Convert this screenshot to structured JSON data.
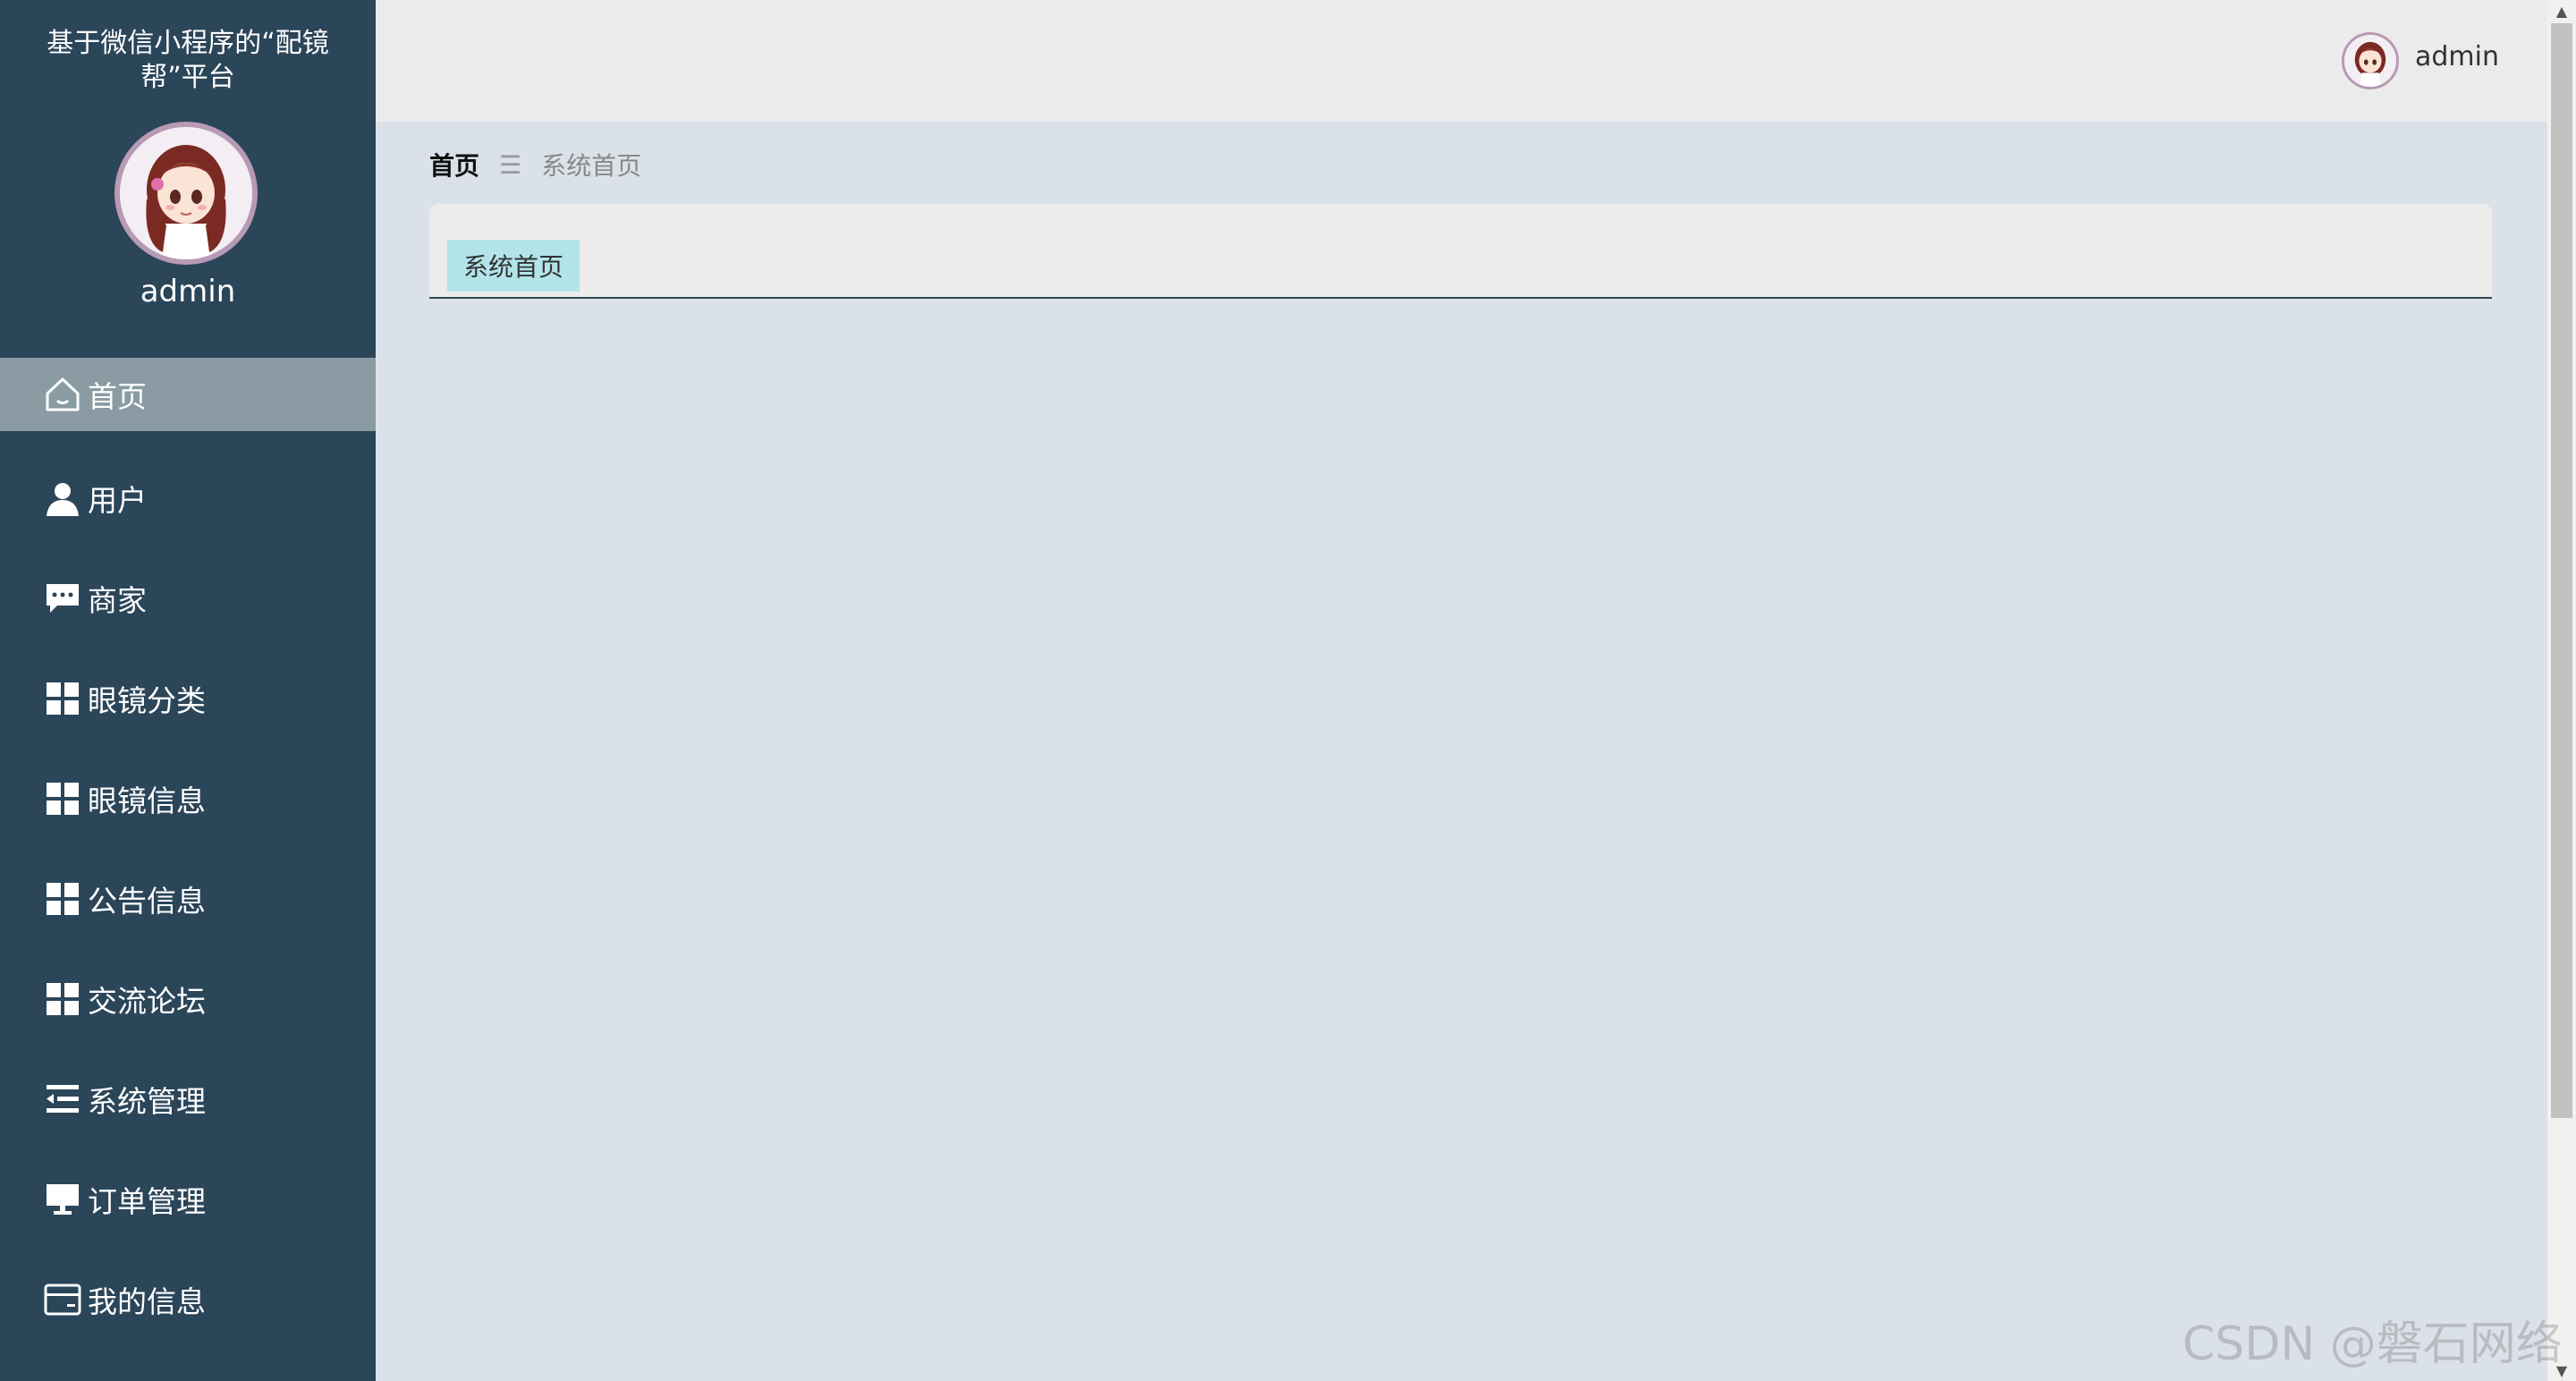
{
  "app": {
    "title": "基于微信小程序的“配镜帮”平台",
    "username": "admin"
  },
  "sidebar": {
    "items": [
      {
        "label": "首页",
        "icon": "home-icon",
        "active": true
      },
      {
        "label": "用户",
        "icon": "user-icon",
        "active": false
      },
      {
        "label": "商家",
        "icon": "chat-icon",
        "active": false
      },
      {
        "label": "眼镜分类",
        "icon": "grid-icon",
        "active": false
      },
      {
        "label": "眼镜信息",
        "icon": "grid-icon",
        "active": false
      },
      {
        "label": "公告信息",
        "icon": "grid-icon",
        "active": false
      },
      {
        "label": "交流论坛",
        "icon": "grid-icon",
        "active": false
      },
      {
        "label": "系统管理",
        "icon": "list-indent-icon",
        "active": false
      },
      {
        "label": "订单管理",
        "icon": "monitor-icon",
        "active": false
      },
      {
        "label": "我的信息",
        "icon": "card-icon",
        "active": false
      }
    ]
  },
  "header": {
    "username": "admin"
  },
  "breadcrumb": {
    "home": "首页",
    "separator": "☰",
    "current": "系统首页"
  },
  "tabs": [
    {
      "label": "系统首页",
      "active": true
    }
  ],
  "watermark": "CSDN @磐石网络",
  "colors": {
    "sidebar_bg": "#2b4559",
    "active_item_bg": "#8a9ba4",
    "content_bg": "#dbe1e9",
    "topbar_bg": "#ebebeb",
    "tab_bg": "#b2e4ea"
  }
}
